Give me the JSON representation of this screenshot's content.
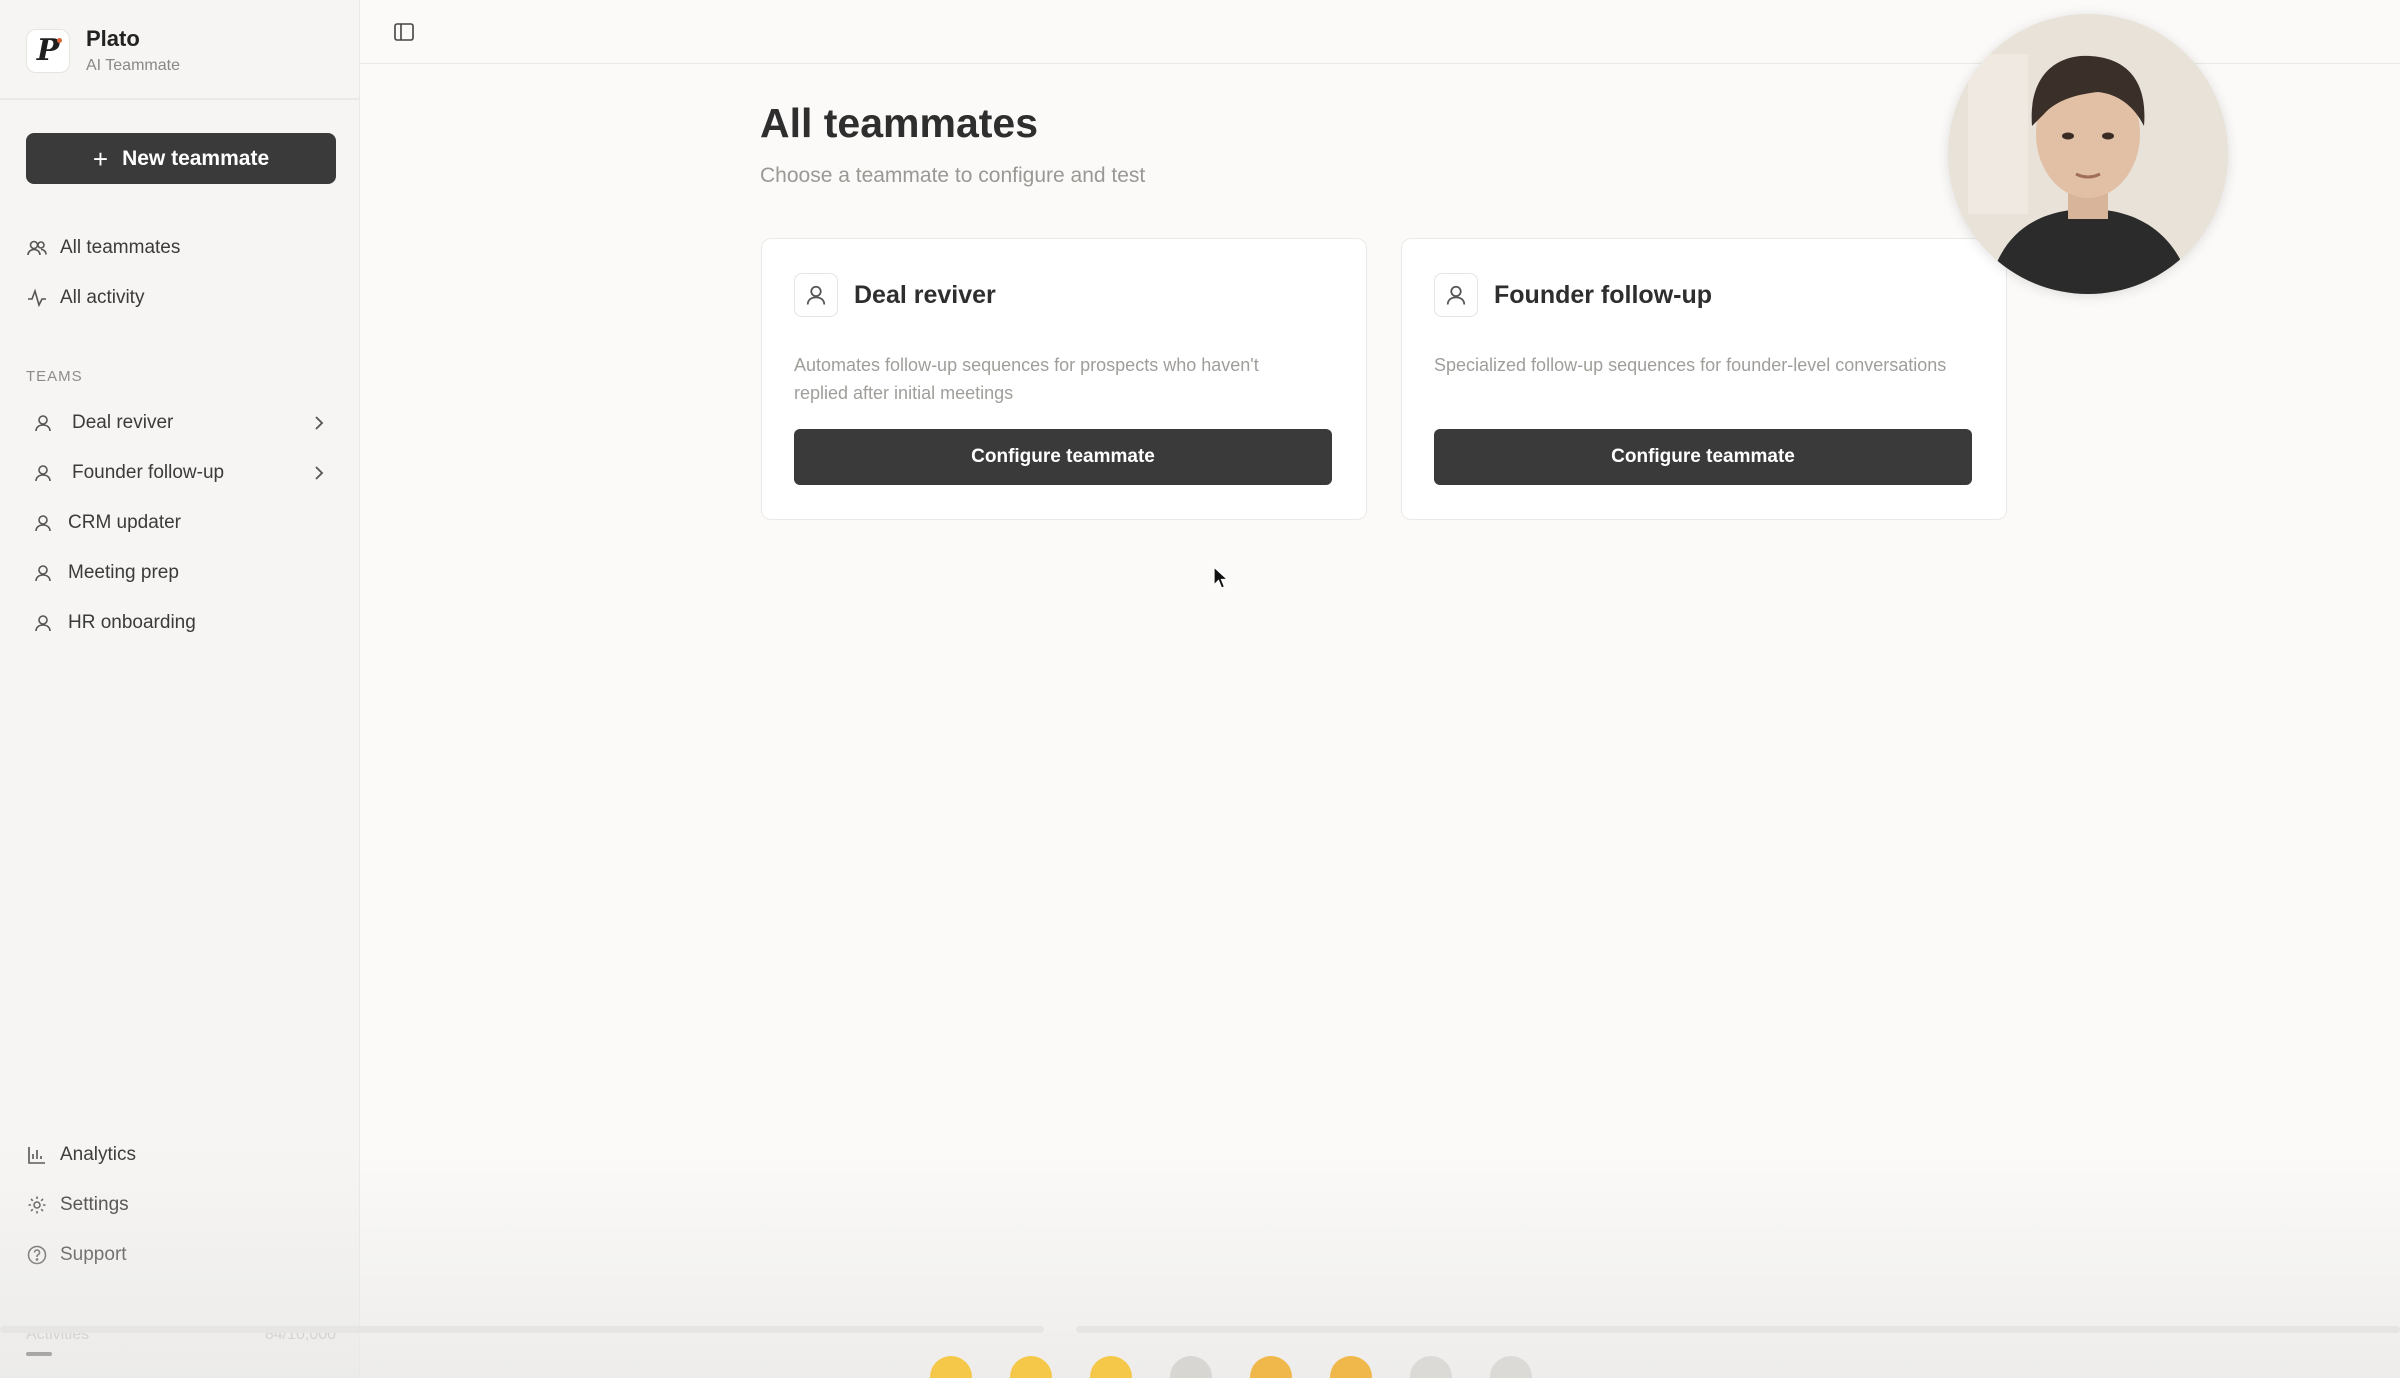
{
  "brand": {
    "name": "Plato",
    "subtitle": "AI Teammate",
    "logo_letter": "P"
  },
  "sidebar": {
    "new_button": {
      "icon": "plus-icon",
      "label": "New teammate"
    },
    "primary_nav": [
      {
        "icon": "users-icon",
        "label": "All teammates"
      },
      {
        "icon": "activity-icon",
        "label": "All activity"
      }
    ],
    "teams_label": "TEAMS",
    "teams": [
      {
        "icon": "user-icon",
        "label": "Deal reviver",
        "expandable": true
      },
      {
        "icon": "user-icon",
        "label": "Founder follow-up",
        "expandable": true
      },
      {
        "icon": "user-icon",
        "label": "CRM updater",
        "expandable": false
      },
      {
        "icon": "user-icon",
        "label": "Meeting prep",
        "expandable": false
      },
      {
        "icon": "user-icon",
        "label": "HR onboarding",
        "expandable": false
      }
    ],
    "bottom_nav": [
      {
        "icon": "bar-chart-icon",
        "label": "Analytics"
      },
      {
        "icon": "gear-icon",
        "label": "Settings"
      },
      {
        "icon": "help-circle-icon",
        "label": "Support"
      }
    ],
    "usage": {
      "label": "Activities",
      "value": "84/10,000"
    }
  },
  "topbar": {
    "toggle_icon": "sidebar-toggle-icon"
  },
  "main": {
    "title": "All teammates",
    "subtitle": "Choose a teammate to configure and test",
    "cards": [
      {
        "icon": "user-icon",
        "title": "Deal reviver",
        "description": "Automates follow-up sequences for prospects who haven't replied after initial meetings",
        "button_label": "Configure teammate"
      },
      {
        "icon": "user-icon",
        "title": "Founder follow-up",
        "description": "Specialized follow-up sequences for founder-level conversations",
        "button_label": "Configure teammate"
      }
    ]
  },
  "colors": {
    "background": "#fbfaf8",
    "sidebar": "#f6f5f3",
    "primary_button": "#3a3a3a",
    "text": "#2e2e2e",
    "muted_text": "#9a9894"
  }
}
